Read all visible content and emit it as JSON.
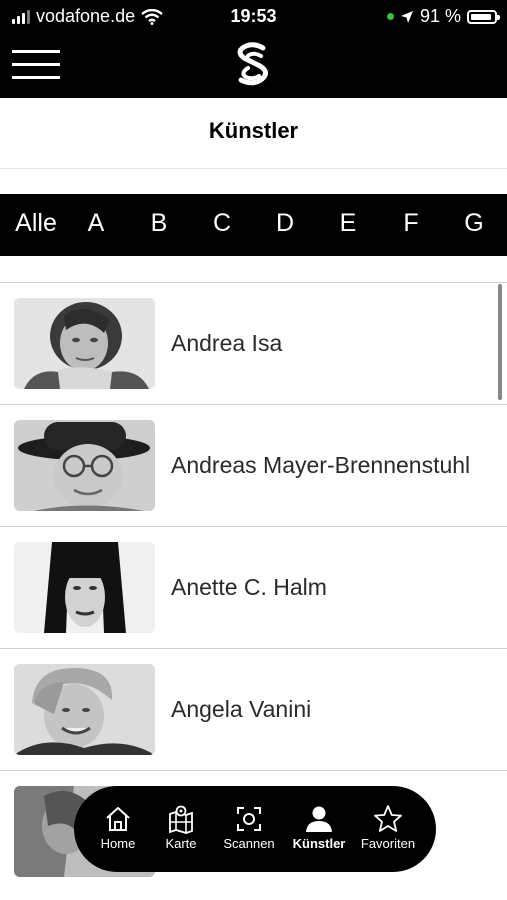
{
  "status": {
    "carrier": "vodafone.de",
    "time": "19:53",
    "battery": "91 %",
    "battery_level": 0.91
  },
  "header": {
    "title": "Künstler"
  },
  "alphabet": [
    "Alle",
    "A",
    "B",
    "C",
    "D",
    "E",
    "F",
    "G"
  ],
  "artists": [
    {
      "name": "Andrea Isa"
    },
    {
      "name": "Andreas Mayer-Brennenstuhl"
    },
    {
      "name": "Anette C. Halm"
    },
    {
      "name": "Angela Vanini"
    },
    {
      "name": ""
    }
  ],
  "tabs": [
    {
      "label": "Home",
      "icon": "home-icon"
    },
    {
      "label": "Karte",
      "icon": "map-icon"
    },
    {
      "label": "Scannen",
      "icon": "scan-icon"
    },
    {
      "label": "Künstler",
      "icon": "person-icon",
      "active": true
    },
    {
      "label": "Favoriten",
      "icon": "star-icon"
    }
  ]
}
